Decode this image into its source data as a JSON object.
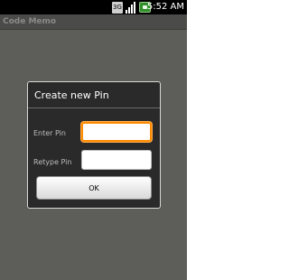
{
  "status_bar": {
    "network_label": "3G",
    "time": "5:52",
    "ampm": "AM",
    "icons": [
      "network-3g-icon",
      "signal-strength-icon",
      "battery-icon"
    ]
  },
  "app": {
    "title": "Code Memo"
  },
  "dialog": {
    "title": "Create new Pin",
    "enter_pin_label": "Enter Pin",
    "enter_pin_value": "",
    "retype_pin_label": "Retype Pin",
    "retype_pin_value": "",
    "ok_label": "OK",
    "focus_color": "#ff8a00"
  }
}
